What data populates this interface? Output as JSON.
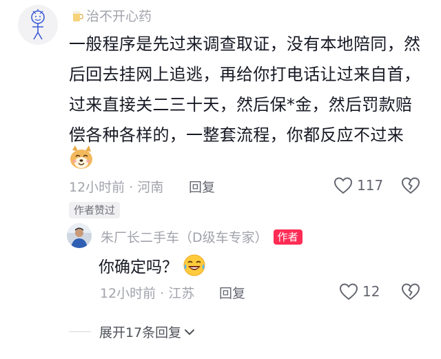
{
  "comment": {
    "username": "治不开心药",
    "text": "一般程序是先过来调查取证，没有本地陪同，然后回去挂网上追逃，再给你打电话让过来自首，过来直接关二三十天，然后保*金，然后罚款赔偿各种各样的，一整套流程，你都反应不过来",
    "time": "12小时前",
    "location": "河南",
    "reply_label": "回复",
    "like_count": "117",
    "author_liked_badge": "作者赞过"
  },
  "reply": {
    "username": "朱厂长二手车（D级车专家）",
    "author_tag": "作者",
    "text": "你确定吗？",
    "time": "12小时前",
    "location": "江苏",
    "reply_label": "回复",
    "like_count": "12"
  },
  "expand_replies": "展开17条回复",
  "icons": {
    "heart": "heart-outline-icon",
    "dislike": "broken-heart-icon",
    "chevron": "chevron-down-icon"
  },
  "colors": {
    "accent": "#fe2c55",
    "meta": "#a1a3ab",
    "text": "#161823"
  }
}
